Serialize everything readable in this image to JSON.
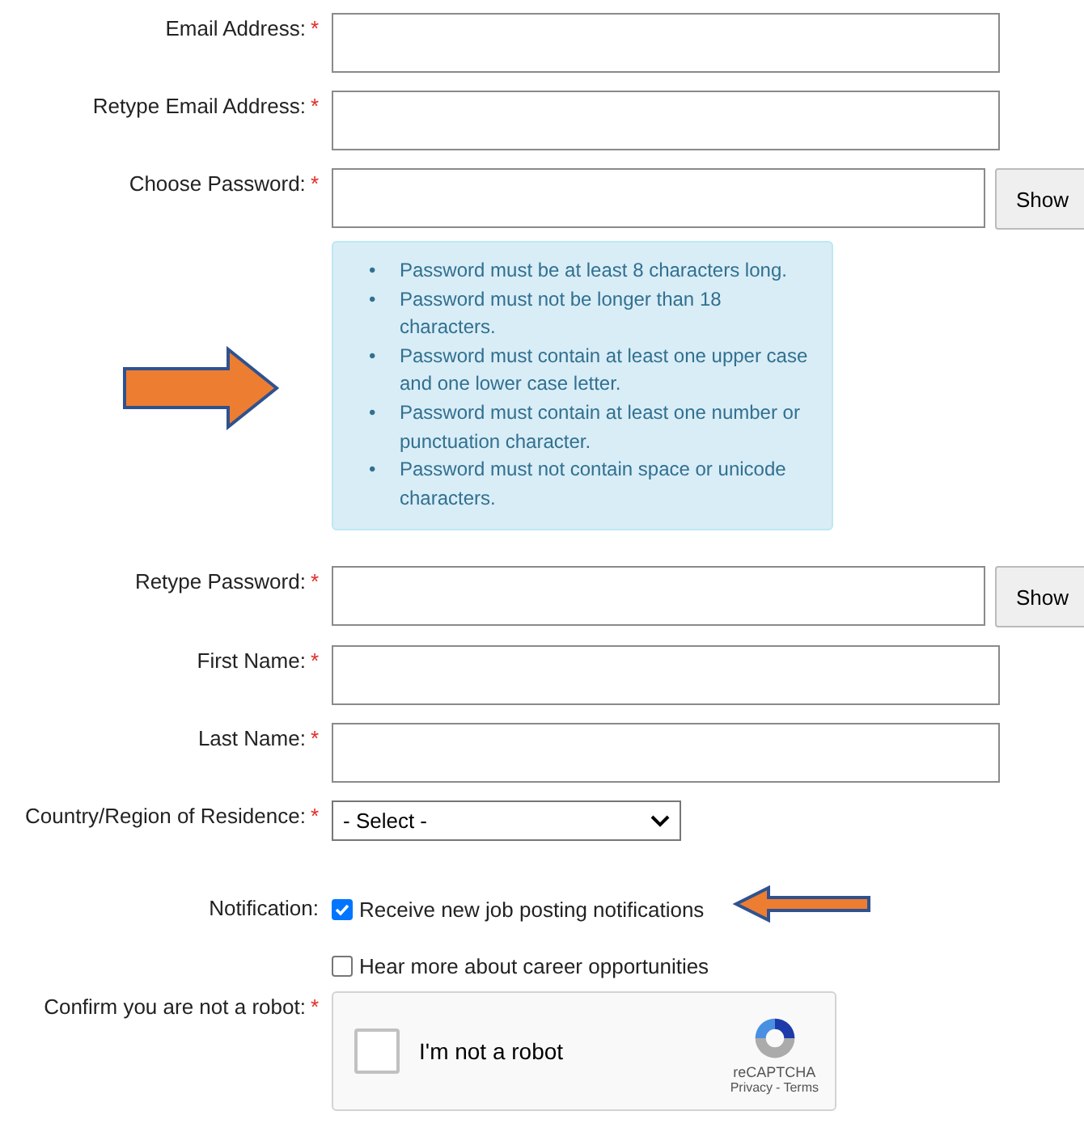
{
  "form": {
    "rows": [
      {
        "kind": "text",
        "label": "Email Address:",
        "mark": "*"
      },
      {
        "kind": "text",
        "label": "Retype Email Address:",
        "mark": "*"
      },
      {
        "kind": "password",
        "label": "Choose Password:",
        "mark": "*",
        "button": "Show"
      },
      {
        "kind": "rules",
        "arrow": true,
        "rules": [
          {
            "bullet": "•",
            "text": "Password must be at least 8 characters long."
          },
          {
            "bullet": "•",
            "text": "Password must not be longer than 18 characters."
          },
          {
            "bullet": "•",
            "text": "Password must contain at least one upper case and one lower case letter."
          },
          {
            "bullet": "•",
            "text": "Password must contain at least one number or punctuation character."
          },
          {
            "bullet": "•",
            "text": "Password must not contain space or unicode characters."
          }
        ]
      },
      {
        "kind": "password",
        "label": "Retype Password:",
        "mark": "*",
        "button": "Show"
      },
      {
        "kind": "text",
        "label": "First Name:",
        "mark": "*"
      },
      {
        "kind": "text",
        "label": "Last Name:",
        "mark": "*"
      },
      {
        "kind": "select",
        "label": "Country/Region of Residence:",
        "mark": "*",
        "value": "- Select -"
      },
      {
        "kind": "checkbox",
        "label": "Notification:",
        "option": "Receive new job posting notifications",
        "checked": true,
        "arrow": true
      },
      {
        "kind": "checkbox",
        "option": "Hear more about career opportunities",
        "checked": false
      },
      {
        "kind": "captcha",
        "label": "Confirm you are not a robot:",
        "mark": "*",
        "text": "I'm not a robot",
        "checked": false,
        "brand": "reCAPTCHA",
        "links": [
          "Privacy",
          "-",
          "Terms"
        ]
      }
    ]
  }
}
